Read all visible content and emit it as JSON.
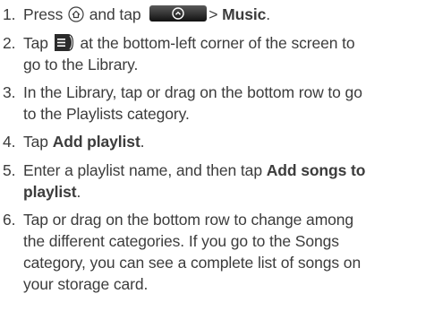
{
  "steps": [
    {
      "num": "1.",
      "text_a": "Press",
      "text_b": "and tap",
      "text_c": "> ",
      "bold_d": "Music",
      "text_e": "."
    },
    {
      "num": "2.",
      "text_a": "Tap",
      "text_b": "at the bottom-left corner of the screen to",
      "line2": "go to the Library."
    },
    {
      "num": "3.",
      "line1": "In the Library, tap or drag on the bottom row to go",
      "line2": "to the Playlists category."
    },
    {
      "num": "4.",
      "text_a": "Tap ",
      "bold_b": "Add playlist",
      "text_c": "."
    },
    {
      "num": "5.",
      "text_a": "Enter a playlist name, and then tap ",
      "bold_b": "Add songs to",
      "bold_line2": "playlist",
      "text_end": "."
    },
    {
      "num": "6.",
      "line1": "Tap or drag on the bottom row to change among",
      "line2": "the different categories. If you go to the Songs",
      "line3": "category, you can see a complete list of songs on",
      "line4": "your storage card."
    }
  ],
  "icons": {
    "home": "home-icon",
    "all_apps": "all-apps-button-icon",
    "library": "library-button-icon"
  }
}
